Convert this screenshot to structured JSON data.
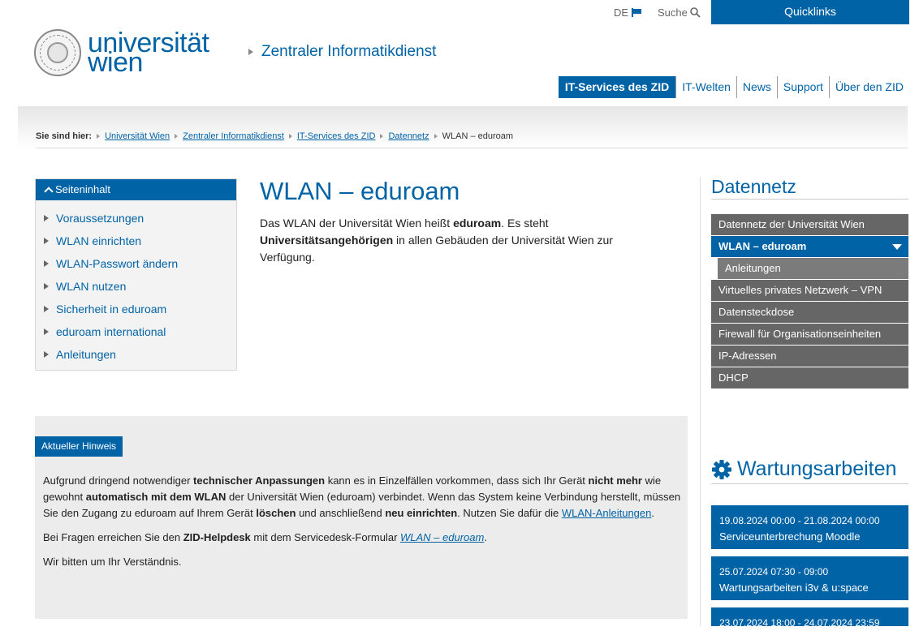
{
  "util": {
    "lang": "DE",
    "search_label": "Suche",
    "quicklinks": "Quicklinks"
  },
  "header": {
    "logo_line1": "universität",
    "logo_line2": "wien",
    "subsite": "Zentraler Informatikdienst",
    "nav": [
      "IT-Services des ZID",
      "IT-Welten",
      "News",
      "Support",
      "Über den ZID"
    ]
  },
  "breadcrumb": {
    "label": "Sie sind hier:",
    "items": [
      "Universität Wien",
      "Zentraler Informatikdienst",
      "IT-Services des ZID",
      "Datennetz"
    ],
    "current": "WLAN – eduroam"
  },
  "toc": {
    "title": "Seiteninhalt",
    "items": [
      "Voraussetzungen",
      "WLAN einrichten",
      "WLAN-Passwort ändern",
      "WLAN nutzen",
      "Sicherheit in eduroam",
      "eduroam international",
      "Anleitungen"
    ]
  },
  "main": {
    "title": "WLAN – eduroam",
    "intro": {
      "t1": "Das WLAN der Universität Wien heißt ",
      "b1": "eduroam",
      "t2": ". Es steht ",
      "b2": "Universitätsangehörigen",
      "t3": " in allen Gebäuden der Universität Wien zur Verfügung."
    }
  },
  "notice": {
    "badge": "Aktueller Hinweis",
    "p1": {
      "t1": "Aufgrund dringend notwendiger ",
      "b1": "technischer Anpassungen",
      "t2": " kann es in Einzelfällen vorkommen, dass sich Ihr Gerät ",
      "b2": "nicht mehr",
      "t3": " wie gewohnt ",
      "b3": "automatisch mit dem WLAN",
      "t4": " der Universität Wien (eduroam) verbindet. Wenn das System keine Verbindung herstellt, müssen Sie den Zugang zu eduroam auf Ihrem Gerät ",
      "b4": "löschen",
      "t5": " und anschließend ",
      "b5": "neu einrichten",
      "t6": ". Nutzen Sie dafür die ",
      "link": "WLAN-Anleitungen",
      "t7": "."
    },
    "p2": {
      "t1": "Bei Fragen erreichen Sie den ",
      "b1": "ZID-Helpdesk",
      "t2": " mit dem Servicedesk-Formular ",
      "link": "WLAN – eduroam",
      "t3": "."
    },
    "p3": "Wir bitten um Ihr Verständnis."
  },
  "sidebar": {
    "title": "Datennetz",
    "items": {
      "i0": "Datennetz der Universität Wien",
      "i1": "WLAN – eduroam",
      "i2": "Anleitungen",
      "i3": "Virtuelles privates Netzwerk – VPN",
      "i4": "Datensteckdose",
      "i5": "Firewall für Organisationseinheiten",
      "i6": "IP-Adressen",
      "i7": "DHCP"
    },
    "maint_title": "Wartungsarbeiten",
    "events": [
      {
        "date": "19.08.2024 00:00 - 21.08.2024 00:00",
        "title": "Serviceunterbrechung Moodle"
      },
      {
        "date": "25.07.2024 07:30 - 09:00",
        "title": "Wartungsarbeiten i3v & u:space"
      },
      {
        "date": "23.07.2024 18:00 - 24.07.2024 23:59",
        "title": ""
      }
    ]
  }
}
